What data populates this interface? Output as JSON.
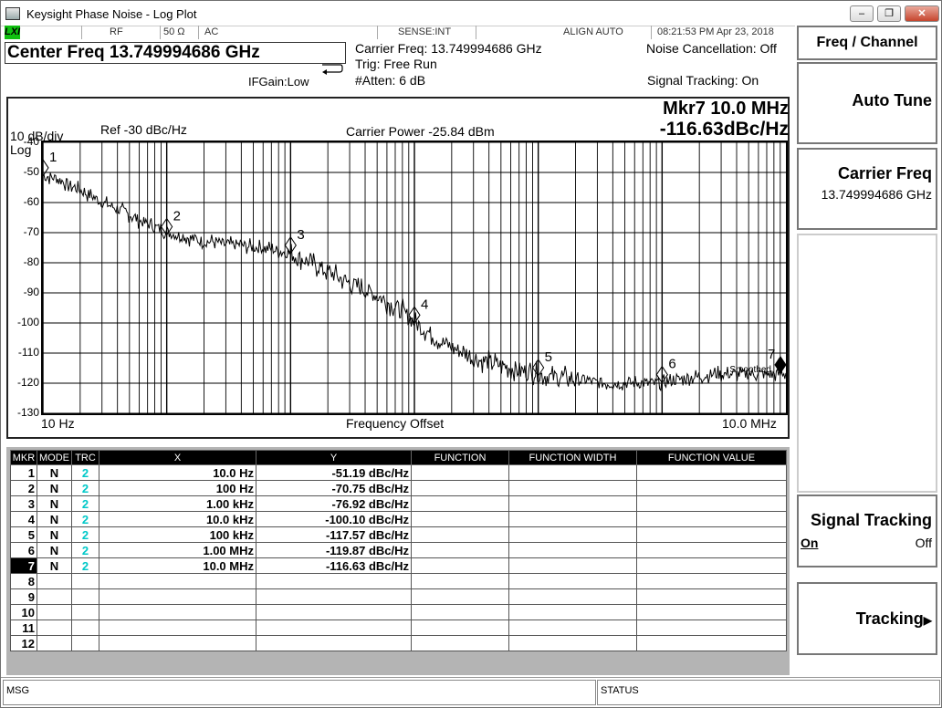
{
  "window": {
    "title": "Keysight Phase Noise - Log Plot",
    "min": "‒",
    "max": "❐",
    "close": "✕"
  },
  "status_bar": {
    "lxi": "LXI",
    "rf": "RF",
    "impedance": "50 Ω",
    "coupling": "AC",
    "sense": "SENSE:INT",
    "align": "ALIGN AUTO",
    "datetime": "08:21:53 PM Apr 23, 2018"
  },
  "header": {
    "center_freq": "Center Freq 13.749994686 GHz",
    "ifgain": "IFGain:Low",
    "carrier_freq": "Carrier Freq: 13.749994686 GHz",
    "trig": "Trig: Free Run",
    "atten": "#Atten: 6 dB",
    "noise_cancel": "Noise Cancellation: Off",
    "signal_tracking": "Signal Tracking: On"
  },
  "plot": {
    "scale": "10 dB/div",
    "scale_type": "Log",
    "ref": "Ref  -30 dBc/Hz",
    "carrier_power": "Carrier Power -25.84 dBm",
    "marker_readout": "Mkr7 10.0 MHz",
    "marker_value": "-116.63dBc/Hz",
    "x_start": "10 Hz",
    "x_label": "Frequency Offset",
    "x_stop": "10.0 MHz",
    "smooth_label": "Smoothed",
    "y_ticks": [
      "-40",
      "-50",
      "-60",
      "-70",
      "-80",
      "-90",
      "-100",
      "-110",
      "-120",
      "-130"
    ]
  },
  "chart_data": {
    "type": "line",
    "xscale": "log",
    "xlim": [
      10,
      10000000
    ],
    "ylim": [
      -130,
      -40
    ],
    "xlabel": "Frequency Offset",
    "ylabel": "dBc/Hz",
    "grid": true,
    "trace": {
      "x": [
        10,
        13,
        16,
        20,
        25,
        30,
        40,
        50,
        60,
        80,
        100,
        130,
        160,
        200,
        250,
        300,
        400,
        500,
        600,
        800,
        1000,
        1300,
        1600,
        2000,
        2500,
        3000,
        4000,
        5000,
        6000,
        8000,
        10000,
        13000,
        16000,
        20000,
        25000,
        30000,
        40000,
        50000,
        60000,
        80000,
        100000,
        130000,
        160000,
        200000,
        250000,
        300000,
        400000,
        500000,
        600000,
        800000,
        1000000,
        1300000,
        1600000,
        2000000,
        2500000,
        3000000,
        4000000,
        5000000,
        6000000,
        8000000,
        10000000
      ],
      "y": [
        -51,
        -52,
        -54,
        -56,
        -58,
        -60,
        -62,
        -64,
        -66,
        -68,
        -70,
        -71,
        -72,
        -73,
        -73,
        -74,
        -74,
        -75,
        -75,
        -76,
        -77,
        -79,
        -81,
        -83,
        -85,
        -87,
        -89,
        -91,
        -93,
        -96,
        -100,
        -103,
        -106,
        -108,
        -110,
        -112,
        -113,
        -114,
        -115,
        -116,
        -117,
        -118,
        -118,
        -119,
        -119,
        -120,
        -120,
        -120,
        -120,
        -120,
        -120,
        -119,
        -118,
        -118,
        -117,
        -117,
        -117,
        -117,
        -117,
        -117,
        -116.6
      ]
    },
    "markers": [
      {
        "n": "1",
        "x": 10,
        "y": -51.19
      },
      {
        "n": "2",
        "x": 100,
        "y": -70.75
      },
      {
        "n": "3",
        "x": 1000,
        "y": -76.92
      },
      {
        "n": "4",
        "x": 10000,
        "y": -100.1
      },
      {
        "n": "5",
        "x": 100000,
        "y": -117.57
      },
      {
        "n": "6",
        "x": 1000000,
        "y": -119.87
      },
      {
        "n": "7",
        "x": 10000000,
        "y": -116.63
      }
    ]
  },
  "marker_table": {
    "headers": {
      "mkr": "MKR",
      "mode": "MODE",
      "trc": "TRC",
      "x": "X",
      "y": "Y",
      "function": "FUNCTION",
      "function_width": "FUNCTION WIDTH",
      "function_value": "FUNCTION VALUE"
    },
    "rows": [
      {
        "num": "1",
        "mode": "N",
        "trc": "2",
        "x": "10.0 Hz",
        "y": "-51.19 dBc/Hz"
      },
      {
        "num": "2",
        "mode": "N",
        "trc": "2",
        "x": "100 Hz",
        "y": "-70.75 dBc/Hz"
      },
      {
        "num": "3",
        "mode": "N",
        "trc": "2",
        "x": "1.00 kHz",
        "y": "-76.92 dBc/Hz"
      },
      {
        "num": "4",
        "mode": "N",
        "trc": "2",
        "x": "10.0 kHz",
        "y": "-100.10 dBc/Hz"
      },
      {
        "num": "5",
        "mode": "N",
        "trc": "2",
        "x": "100 kHz",
        "y": "-117.57 dBc/Hz"
      },
      {
        "num": "6",
        "mode": "N",
        "trc": "2",
        "x": "1.00 MHz",
        "y": "-119.87 dBc/Hz"
      },
      {
        "num": "7",
        "mode": "N",
        "trc": "2",
        "x": "10.0 MHz",
        "y": "-116.63 dBc/Hz",
        "selected": true
      },
      {
        "num": "8",
        "mode": "",
        "trc": "",
        "x": "",
        "y": ""
      },
      {
        "num": "9",
        "mode": "",
        "trc": "",
        "x": "",
        "y": ""
      },
      {
        "num": "10",
        "mode": "",
        "trc": "",
        "x": "",
        "y": ""
      },
      {
        "num": "11",
        "mode": "",
        "trc": "",
        "x": "",
        "y": ""
      },
      {
        "num": "12",
        "mode": "",
        "trc": "",
        "x": "",
        "y": ""
      }
    ]
  },
  "message_bar": {
    "msg": "MSG",
    "status": "STATUS"
  },
  "softkeys": {
    "menu_title": "Freq / Channel",
    "auto_tune": "Auto Tune",
    "carrier_freq": "Carrier Freq",
    "carrier_freq_value": "13.749994686 GHz",
    "signal_tracking": "Signal Tracking",
    "on": "On",
    "off": "Off",
    "tracking": "Tracking",
    "tracking_arrow": "▶"
  }
}
